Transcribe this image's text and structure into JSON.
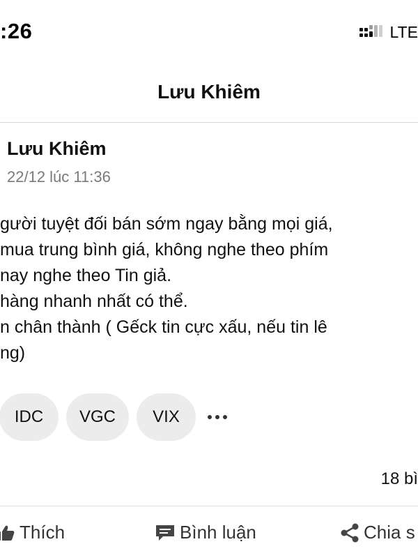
{
  "status_bar": {
    "time": ":26",
    "network": "LTE",
    "signal_icon": "signal-bars-icon"
  },
  "header": {
    "title": "Lưu Khiêm"
  },
  "post": {
    "author": "Lưu Khiêm",
    "time": "22/12 lúc 11:36",
    "lines": [
      "gười tuyệt đối bán sớm ngay bằng mọi giá,",
      " mua trung bình giá, không nghe theo phím",
      "nay nghe theo Tin giả.",
      " hàng nhanh nhất có thể.",
      "n chân thành ( Gếck tin cực xấu, nếu tin lê",
      "ng)"
    ],
    "tags": [
      "IDC",
      "VGC",
      "VIX"
    ],
    "more_icon": "more-horizontal-icon",
    "comment_count": "18 bì"
  },
  "actions": {
    "like": {
      "label": "Thích",
      "icon": "thumbs-up-icon"
    },
    "comment": {
      "label": "Bình luận",
      "icon": "comment-bubble-icon"
    },
    "share": {
      "label": "Chia s",
      "icon": "share-icon"
    }
  }
}
